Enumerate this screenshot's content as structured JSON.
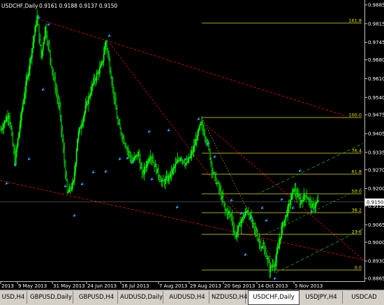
{
  "window": {
    "title": "USDCHF,Daily",
    "ohlc": "0.9161 0.9188 0.9137 0.9150"
  },
  "price_axis": {
    "labels": [
      "0.9885",
      "0.9815",
      "0.9745",
      "0.9680",
      "0.9610",
      "0.9540",
      "0.9475",
      "0.9405",
      "0.9335",
      "0.9270",
      "0.9200",
      "0.9135",
      "0.9065",
      "0.9000",
      "0.8930",
      "0.8865"
    ],
    "current_price": "0.9150"
  },
  "time_axis": {
    "labels": [
      "2013",
      "9 May 2013",
      "31 May 2013",
      "24 Jun 2013",
      "16 Jul 2013",
      "7 Aug 2013",
      "29 Aug 2013",
      "20 Sep 2013",
      "14 Oct 2013",
      "5 Nov 2013"
    ]
  },
  "fibonacci": {
    "levels": [
      "161.8",
      "100.0",
      "76.4",
      "61.8",
      "50.0",
      "38.2",
      "23.6",
      "0.0"
    ]
  },
  "tabs": [
    {
      "label": "USD,H4",
      "active": false
    },
    {
      "label": "GBPUSD,Daily",
      "active": false
    },
    {
      "label": "GBPUSD,H4",
      "active": false
    },
    {
      "label": "AUDUSD,Daily",
      "active": false
    },
    {
      "label": "AUDUSD,H4",
      "active": false
    },
    {
      "label": "NZDUSD,H4",
      "active": false
    },
    {
      "label": "USDCHF,Daily",
      "active": true
    },
    {
      "label": "USDJPY,H4",
      "active": false
    },
    {
      "label": "USDCAD",
      "active": false
    }
  ],
  "colors": {
    "background": "#000000",
    "bull": "#00ff00",
    "bear": "#00ff00",
    "trendline": "#d01010",
    "fib": "#e6e600",
    "channel": "#1aa51a",
    "marker": "#30a0ff"
  },
  "chart_data": {
    "type": "candlestick",
    "ylim": [
      0.8865,
      0.9885
    ],
    "symbol": "USDCHF,Daily",
    "keypoints": [
      {
        "i": 0,
        "y": 0.942
      },
      {
        "i": 8,
        "y": 0.948
      },
      {
        "i": 14,
        "y": 0.93
      },
      {
        "i": 22,
        "y": 0.952
      },
      {
        "i": 30,
        "y": 0.97
      },
      {
        "i": 36,
        "y": 0.984
      },
      {
        "i": 40,
        "y": 0.969
      },
      {
        "i": 44,
        "y": 0.98
      },
      {
        "i": 52,
        "y": 0.962
      },
      {
        "i": 58,
        "y": 0.95
      },
      {
        "i": 66,
        "y": 0.918
      },
      {
        "i": 72,
        "y": 0.922
      },
      {
        "i": 76,
        "y": 0.939
      },
      {
        "i": 84,
        "y": 0.95
      },
      {
        "i": 92,
        "y": 0.96
      },
      {
        "i": 100,
        "y": 0.966
      },
      {
        "i": 104,
        "y": 0.975
      },
      {
        "i": 110,
        "y": 0.96
      },
      {
        "i": 116,
        "y": 0.944
      },
      {
        "i": 122,
        "y": 0.938
      },
      {
        "i": 130,
        "y": 0.93
      },
      {
        "i": 136,
        "y": 0.933
      },
      {
        "i": 140,
        "y": 0.925
      },
      {
        "i": 148,
        "y": 0.933
      },
      {
        "i": 154,
        "y": 0.927
      },
      {
        "i": 160,
        "y": 0.922
      },
      {
        "i": 166,
        "y": 0.924
      },
      {
        "i": 172,
        "y": 0.928
      },
      {
        "i": 178,
        "y": 0.932
      },
      {
        "i": 184,
        "y": 0.929
      },
      {
        "i": 190,
        "y": 0.934
      },
      {
        "i": 198,
        "y": 0.944
      },
      {
        "i": 204,
        "y": 0.938
      },
      {
        "i": 210,
        "y": 0.926
      },
      {
        "i": 216,
        "y": 0.92
      },
      {
        "i": 222,
        "y": 0.912
      },
      {
        "i": 228,
        "y": 0.91
      },
      {
        "i": 232,
        "y": 0.902
      },
      {
        "i": 238,
        "y": 0.908
      },
      {
        "i": 244,
        "y": 0.912
      },
      {
        "i": 250,
        "y": 0.906
      },
      {
        "i": 256,
        "y": 0.9
      },
      {
        "i": 262,
        "y": 0.896
      },
      {
        "i": 266,
        "y": 0.89
      },
      {
        "i": 272,
        "y": 0.893
      },
      {
        "i": 278,
        "y": 0.905
      },
      {
        "i": 284,
        "y": 0.912
      },
      {
        "i": 290,
        "y": 0.92
      },
      {
        "i": 296,
        "y": 0.915
      },
      {
        "i": 302,
        "y": 0.918
      },
      {
        "i": 308,
        "y": 0.913
      },
      {
        "i": 314,
        "y": 0.915
      }
    ]
  }
}
